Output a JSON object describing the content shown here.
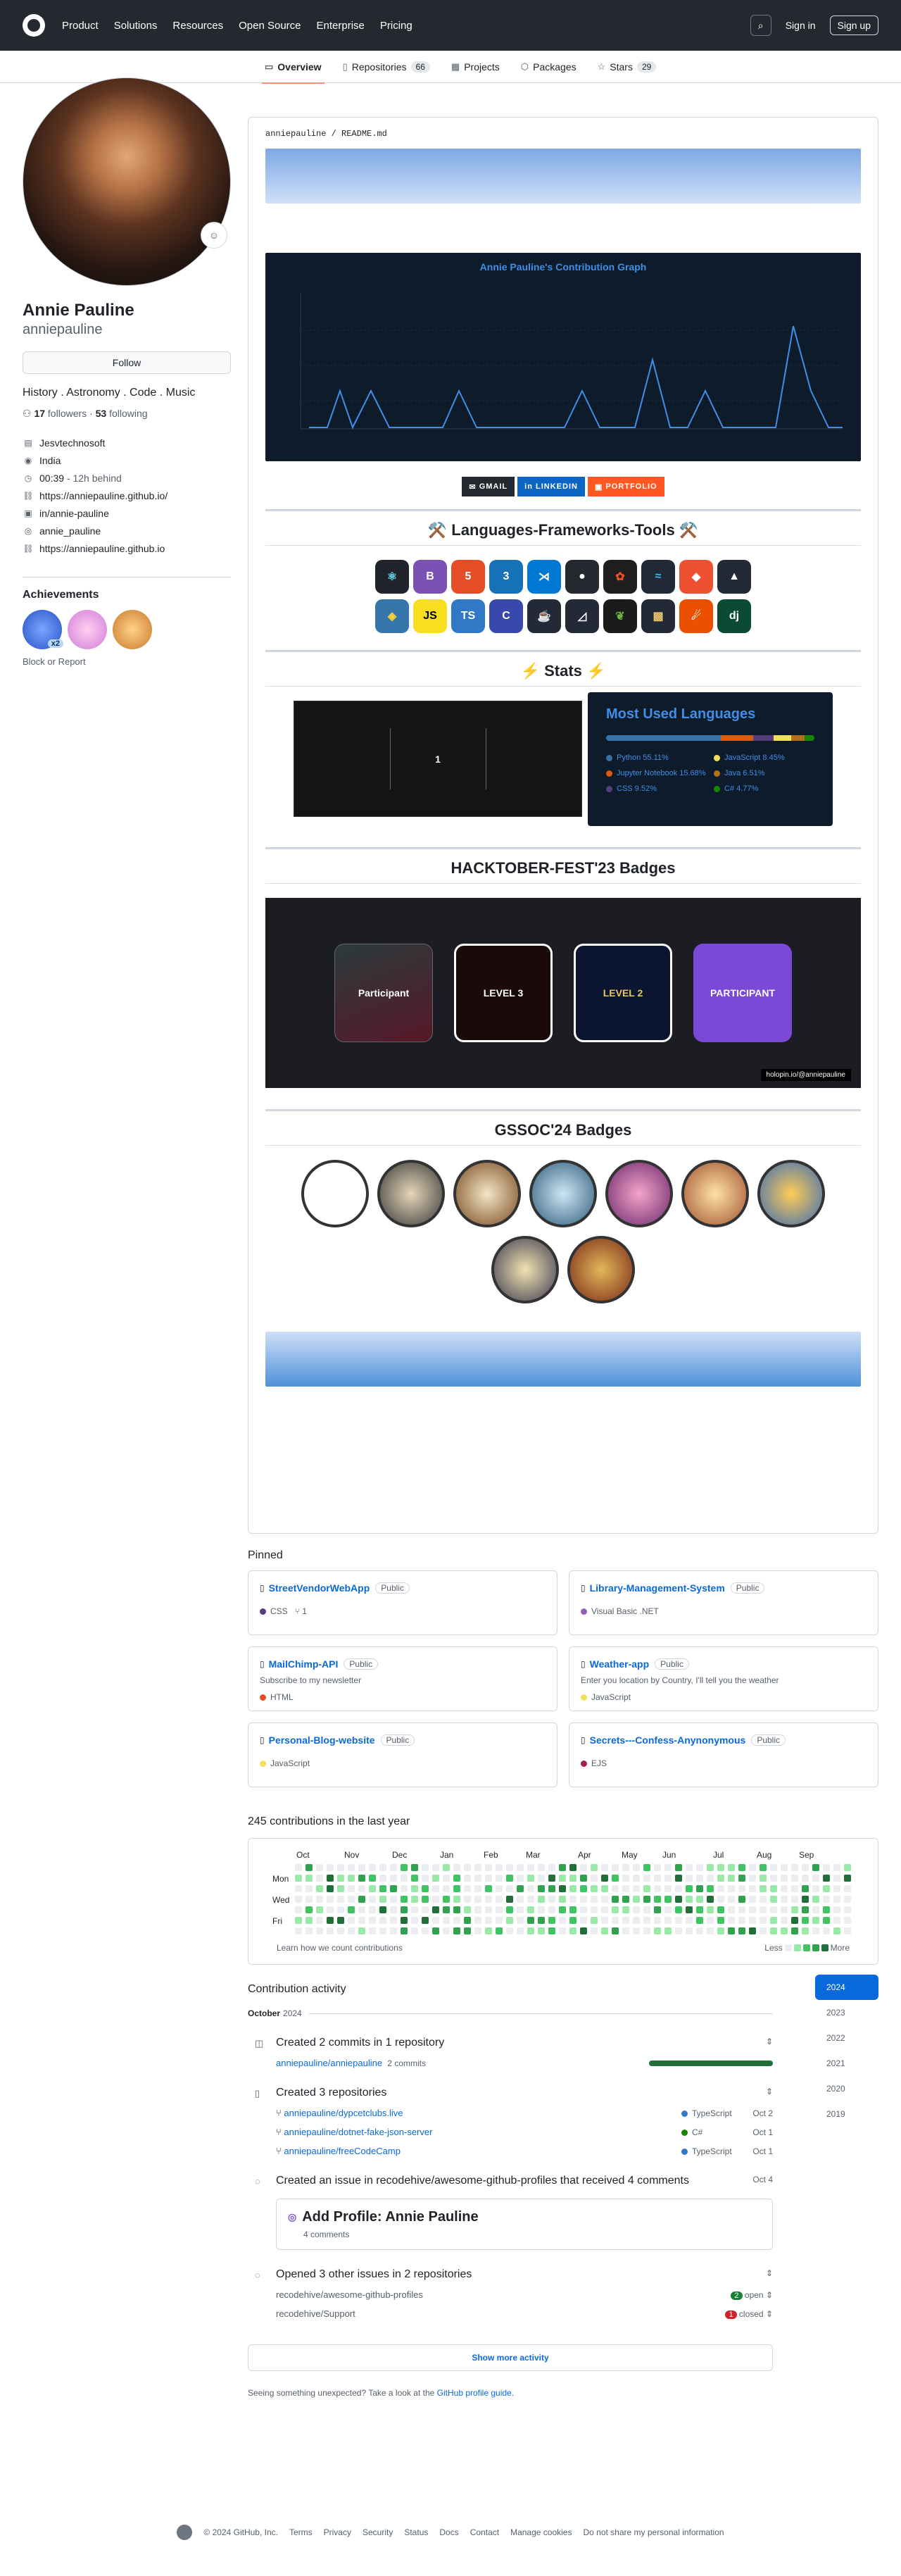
{
  "header": {
    "nav": [
      "Product",
      "Solutions",
      "Resources",
      "Open Source",
      "Enterprise",
      "Pricing"
    ],
    "sign_in": "Sign in",
    "sign_up": "Sign up"
  },
  "tabs": [
    {
      "label": "Overview",
      "count": ""
    },
    {
      "label": "Repositories",
      "count": "66"
    },
    {
      "label": "Projects",
      "count": ""
    },
    {
      "label": "Packages",
      "count": ""
    },
    {
      "label": "Stars",
      "count": "29"
    }
  ],
  "profile": {
    "name": "Annie Pauline",
    "login": "anniepauline",
    "follow": "Follow",
    "bio": "History . Astronomy . Code . Music",
    "followers": "17",
    "followers_label": "followers",
    "following": "53",
    "following_label": "following",
    "company": "Jesvtechnosoft",
    "location": "India",
    "time": "00:39",
    "time_note": "- 12h behind",
    "website": "https://anniepauline.github.io/",
    "linkedin": "in/annie-pauline",
    "instagram": "annie_pauline",
    "link2": "https://anniepauline.github.io",
    "achievements_title": "Achievements",
    "badge_count": "x2",
    "block": "Block or Report"
  },
  "readme": {
    "path_user": "anniepauline",
    "path_file": "README.md",
    "graph_title": "Annie Pauline's Contribution Graph",
    "shields": [
      "GMAIL",
      "LINKEDIN",
      "PORTFOLIO"
    ],
    "tools_title": "⚒️ Languages-Frameworks-Tools ⚒️",
    "stats_title": "⚡ Stats ⚡",
    "stats_number": "1",
    "most_used_title": "Most Used Languages",
    "languages": [
      {
        "name": "Python 55.11%",
        "color": "#3572A5"
      },
      {
        "name": "JavaScript 8.45%",
        "color": "#f1e05a"
      },
      {
        "name": "Jupyter Notebook 15.68%",
        "color": "#DA5B0B"
      },
      {
        "name": "Java 6.51%",
        "color": "#b07219"
      },
      {
        "name": "CSS 9.52%",
        "color": "#563d7c"
      },
      {
        "name": "C# 4.77%",
        "color": "#178600"
      }
    ],
    "hack_title": "HACKTOBER-FEST'23 Badges",
    "hack_badges": [
      "Participant",
      "LEVEL 3",
      "LEVEL 2",
      "PARTICIPANT"
    ],
    "hack_credit": "holopin.io/@anniepauline",
    "gssoc_title": "GSSOC'24 Badges"
  },
  "pinned": {
    "title": "Pinned",
    "repos": [
      {
        "name": "StreetVendorWebApp",
        "vis": "Public",
        "desc": "",
        "lang": "CSS",
        "color": "#563d7c",
        "forks": "1"
      },
      {
        "name": "Library-Management-System",
        "vis": "Public",
        "desc": "",
        "lang": "Visual Basic .NET",
        "color": "#945db7",
        "forks": ""
      },
      {
        "name": "MailChimp-API",
        "vis": "Public",
        "desc": "Subscribe to my newsletter",
        "lang": "HTML",
        "color": "#e34c26",
        "forks": ""
      },
      {
        "name": "Weather-app",
        "vis": "Public",
        "desc": "Enter you location by Country, I'll tell you the weather",
        "lang": "JavaScript",
        "color": "#f1e05a",
        "forks": ""
      },
      {
        "name": "Personal-Blog-website",
        "vis": "Public",
        "desc": "",
        "lang": "JavaScript",
        "color": "#f1e05a",
        "forks": ""
      },
      {
        "name": "Secrets---Confess-Anynonymous",
        "vis": "Public",
        "desc": "",
        "lang": "EJS",
        "color": "#a91e50",
        "forks": ""
      }
    ]
  },
  "contributions": {
    "title": "245 contributions in the last year",
    "months": [
      "Oct",
      "Nov",
      "Dec",
      "Jan",
      "Feb",
      "Mar",
      "Apr",
      "May",
      "Jun",
      "Jul",
      "Aug",
      "Sep"
    ],
    "days": [
      "Mon",
      "Wed",
      "Fri"
    ],
    "learn": "Learn how we count contributions",
    "less": "Less",
    "more": "More"
  },
  "activity": {
    "title": "Contribution activity",
    "years": [
      "2024",
      "2023",
      "2022",
      "2021",
      "2020",
      "2019"
    ],
    "month": "October",
    "month_year": "2024",
    "ev1": "Created 2 commits in 1 repository",
    "ev1_repo": "anniepauline/anniepauline",
    "ev1_commits": "2 commits",
    "ev2": "Created 3 repositories",
    "ev2_repos": [
      {
        "name": "anniepauline/dypcetclubs.live",
        "lang": "TypeScript",
        "color": "#3178c6",
        "date": "Oct 2"
      },
      {
        "name": "anniepauline/dotnet-fake-json-server",
        "lang": "C#",
        "color": "#178600",
        "date": "Oct 1"
      },
      {
        "name": "anniepauline/freeCodeCamp",
        "lang": "TypeScript",
        "color": "#3178c6",
        "date": "Oct 1"
      }
    ],
    "ev3": "Created an issue in recodehive/awesome-github-profiles that received 4 comments",
    "ev3_date": "Oct 4",
    "issue_title": "Add Profile: Annie Pauline",
    "issue_comments": "4 comments",
    "ev4": "Opened 3 other issues in 2 repositories",
    "ev4_rows": [
      {
        "repo": "recodehive/awesome-github-profiles",
        "count": "2",
        "state": "open",
        "color": "#1a7f37"
      },
      {
        "repo": "recodehive/Support",
        "count": "1",
        "state": "closed",
        "color": "#cf222e"
      }
    ],
    "show_more": "Show more activity",
    "unexpected": "Seeing something unexpected? Take a look at the",
    "unexpected_link": "GitHub profile guide"
  },
  "footer": [
    "© 2024 GitHub, Inc.",
    "Terms",
    "Privacy",
    "Security",
    "Status",
    "Docs",
    "Contact",
    "Manage cookies",
    "Do not share my personal information"
  ]
}
